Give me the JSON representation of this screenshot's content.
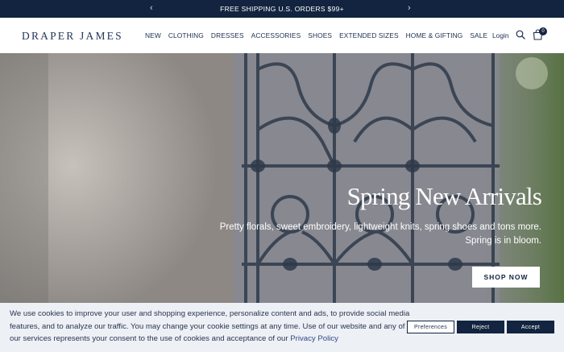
{
  "announcement": {
    "text": "FREE SHIPPING U.S. ORDERS $99+",
    "prev_arrow": "‹",
    "next_arrow": "›"
  },
  "header": {
    "logo": "DRAPER JAMES",
    "nav": [
      "NEW",
      "CLOTHING",
      "DRESSES",
      "ACCESSORIES",
      "SHOES",
      "EXTENDED SIZES",
      "HOME & GIFTING",
      "SALE"
    ],
    "login": "Login",
    "cart_count": "0",
    "icons": {
      "search": "search-icon",
      "cart": "shopping-bag-icon"
    }
  },
  "hero": {
    "title": "Spring New Arrivals",
    "subtitle_line1": "Pretty florals, sweet embroidery, lightweight knits, spring shoes and tons more.",
    "subtitle_line2": "Spring is in bloom.",
    "cta": "SHOP NOW"
  },
  "cookie_banner": {
    "text": "We use cookies to improve your user and shopping experience, personalize content and ads, to provide social media features, and to analyze our traffic. You may change your cookie settings at any time. Use of our website and any of our services represents your consent to the use of cookies and acceptance of our ",
    "policy_link": "Privacy Policy",
    "preferences": "Preferences",
    "reject": "Reject",
    "accept": "Accept"
  },
  "colors": {
    "navy": "#12243f",
    "banner_bg": "#edf0f5"
  }
}
